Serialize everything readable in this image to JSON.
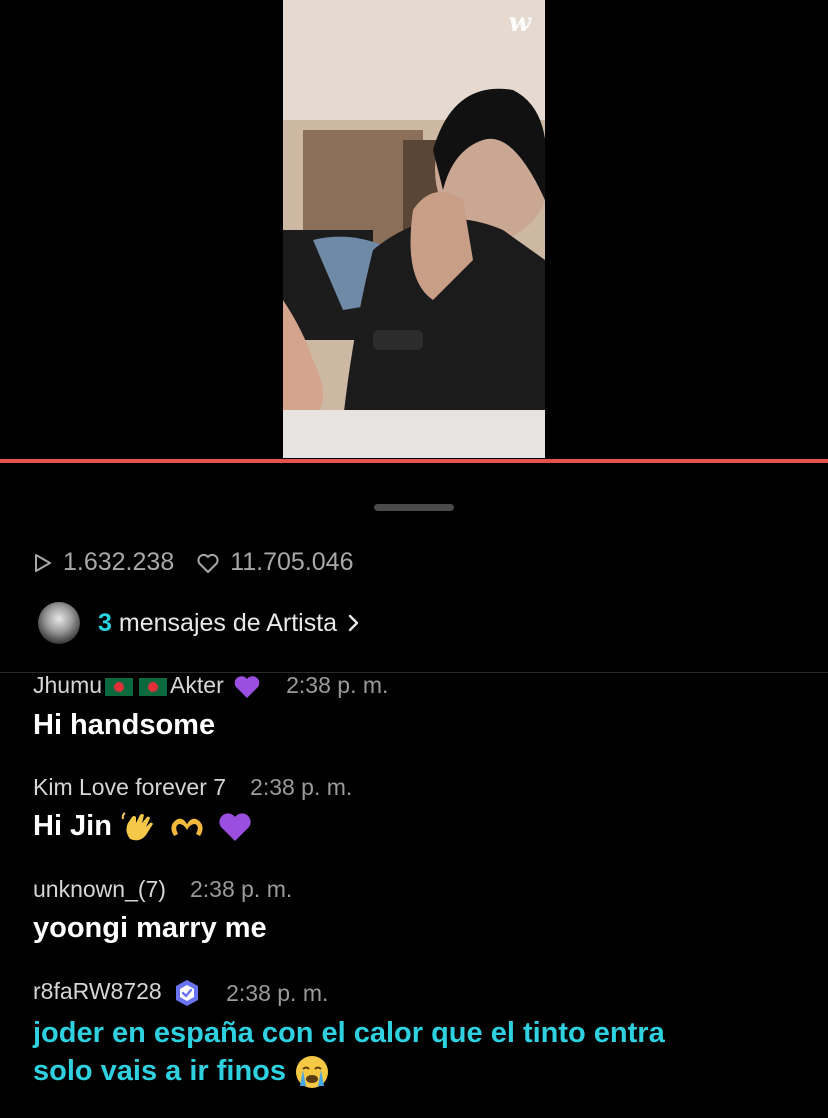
{
  "video": {
    "logo": "w"
  },
  "stats": {
    "plays": "1.632.238",
    "likes": "11.705.046",
    "play_icon": "play-outline-icon",
    "like_icon": "heart-outline-icon"
  },
  "artist_messages": {
    "count": "3",
    "label": "mensajes de Artista",
    "chevron_icon": "chevron-right-icon"
  },
  "colors": {
    "accent": "#29d3e0",
    "progress": "#e5534b",
    "background": "#000000"
  },
  "comments": [
    {
      "user_pre": "Jhumu",
      "user_post": "Akter",
      "time": "2:38 p. m.",
      "text": "Hi handsome"
    },
    {
      "user": "Kim Love forever 7",
      "time": "2:38 p. m.",
      "text": "Hi Jin"
    },
    {
      "user": "unknown_(7)",
      "time": "2:38 p. m.",
      "text": "yoongi marry me"
    },
    {
      "user": "r8faRW8728",
      "time": "2:38 p. m.",
      "text_line1": "joder en españa con el calor que el tinto entra",
      "text_line2": "solo vais a ir finos"
    }
  ]
}
